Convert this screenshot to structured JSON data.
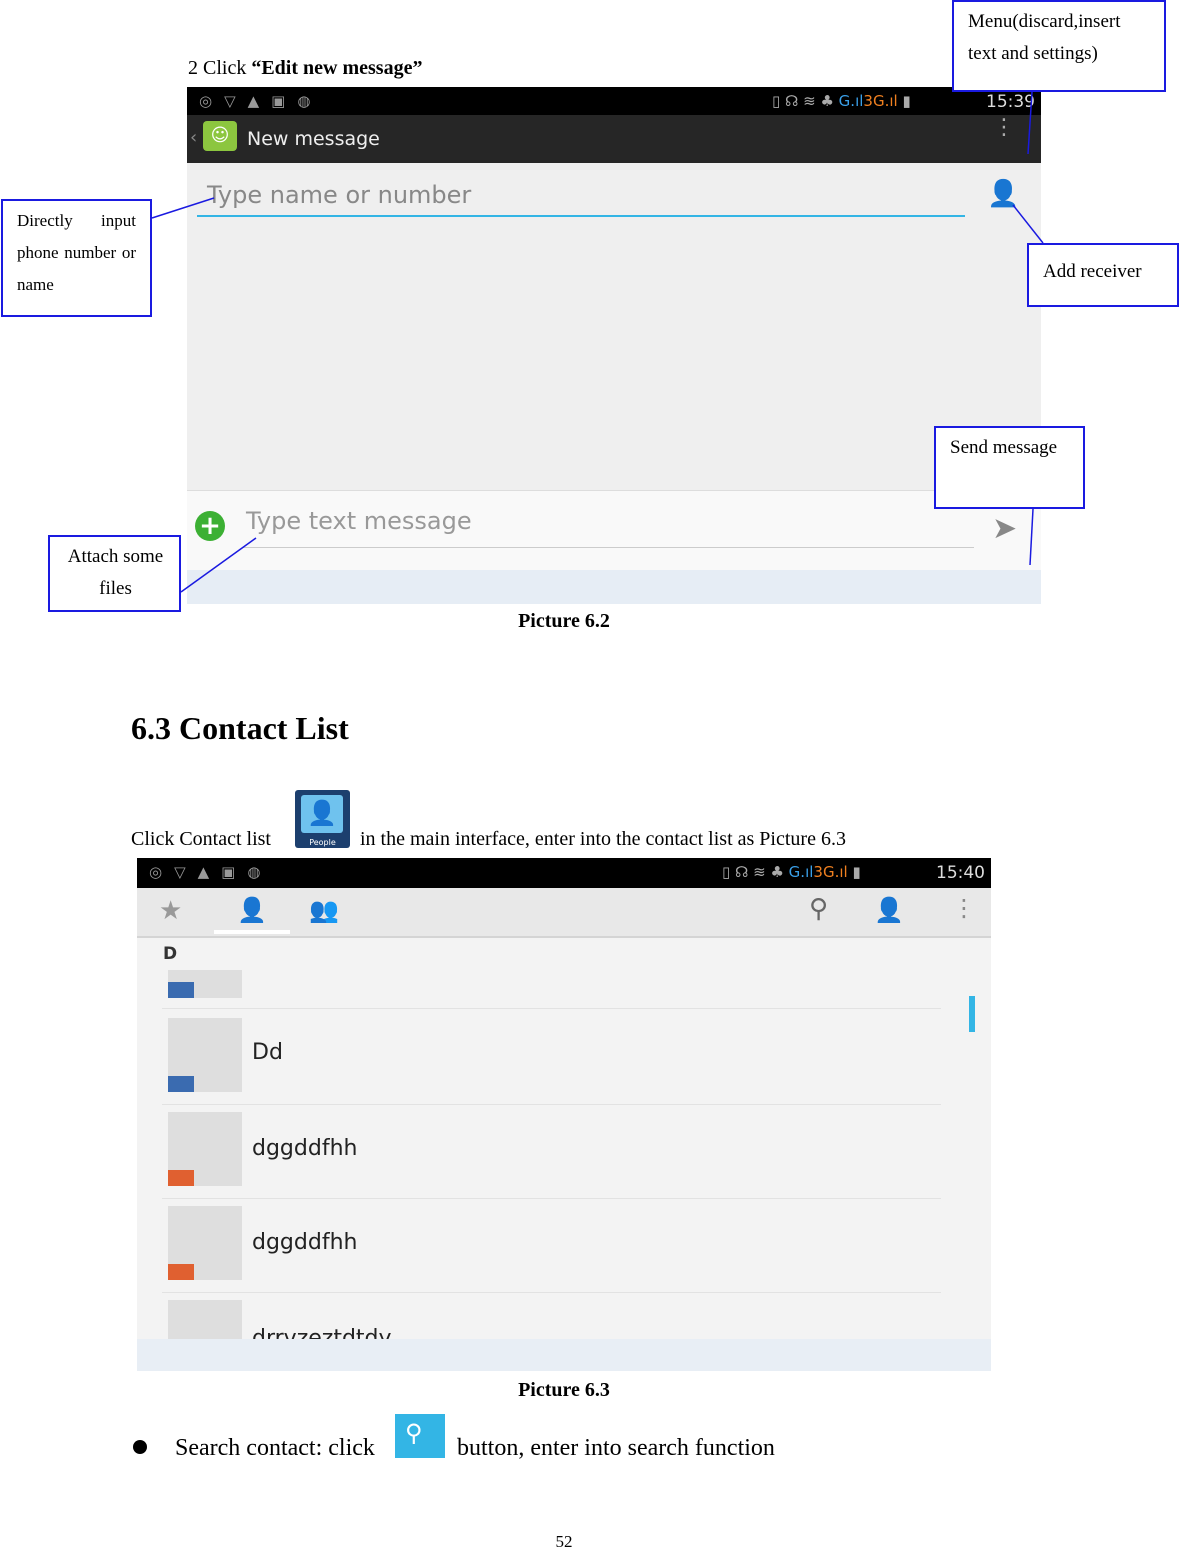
{
  "step": {
    "prefix": "2 Click ",
    "bold": "“Edit new message”"
  },
  "picture62": {
    "status_time": "15:39",
    "network_g": "G",
    "network_3g": "3G",
    "title": "New message",
    "recipient_placeholder": "Type name or number",
    "message_placeholder": "Type text message",
    "caption": "Picture 6.2"
  },
  "callouts": {
    "menu": "Menu(discard,insert text and settings)",
    "direct_input": "Directly input phone number or name",
    "add_receiver": "Add receiver",
    "send": "Send message",
    "attach": "Attach some files"
  },
  "section": {
    "title": "6.3 Contact List"
  },
  "intro": {
    "before": "Click Contact list",
    "icon_label": "People",
    "after": "in the main interface, enter into the contact list as Picture 6.3"
  },
  "picture63": {
    "status_time": "15:40",
    "network_g": "G",
    "network_3g": "3G",
    "section_letter": "D",
    "contacts": [
      "",
      "Dd",
      "dggddfhh",
      "dggddfhh",
      "drrvzeztdtdy"
    ],
    "caption": "Picture 6.3"
  },
  "bullet": {
    "before": "Search contact: click",
    "after": "button, enter into search function"
  },
  "page_number": "52",
  "colors": {
    "callout_border": "#1a1ae0",
    "accent": "#33b5e5",
    "message_green": "#8cc63f"
  }
}
